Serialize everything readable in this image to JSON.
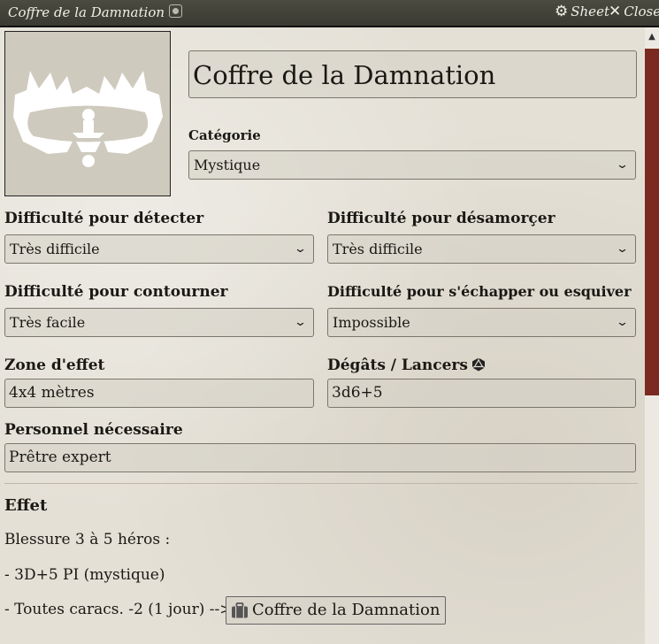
{
  "window": {
    "title": "Coffre de la Damnation",
    "sheet_label": "Sheet",
    "close_label": "Close"
  },
  "item": {
    "name": "Coffre de la Damnation",
    "portrait_icon": "bear-trap-icon"
  },
  "category": {
    "label": "Catégorie",
    "value": "Mystique"
  },
  "detect": {
    "label": "Difficulté pour détecter",
    "value": "Très difficile"
  },
  "disarm": {
    "label": "Difficulté pour désamorçer",
    "value": "Très difficile"
  },
  "bypass": {
    "label": "Difficulté pour contourner",
    "value": "Très facile"
  },
  "escape": {
    "label": "Difficulté pour s'échapper ou esquiver",
    "value": "Impossible"
  },
  "area": {
    "label": "Zone d'effet",
    "value": "4x4 mètres"
  },
  "damage": {
    "label": "Dégâts / Lancers",
    "value": "3d6+5",
    "icon": "dice-icon"
  },
  "personnel": {
    "label": "Personnel nécessaire",
    "value": "Prêtre expert"
  },
  "effect": {
    "heading": "Effet",
    "line1": "Blessure 3 à 5 héros :",
    "line2": "- 3D+5 PI (mystique)",
    "line3_prefix": "- Toutes caracs. -2 (1 jour) -->",
    "link_label": "Coffre de la Damnation",
    "link_icon": "briefcase-icon"
  },
  "colors": {
    "titlebar": "#3f3f37",
    "scroll_thumb": "#7a2a20",
    "parchment": "#e4e0d6"
  }
}
